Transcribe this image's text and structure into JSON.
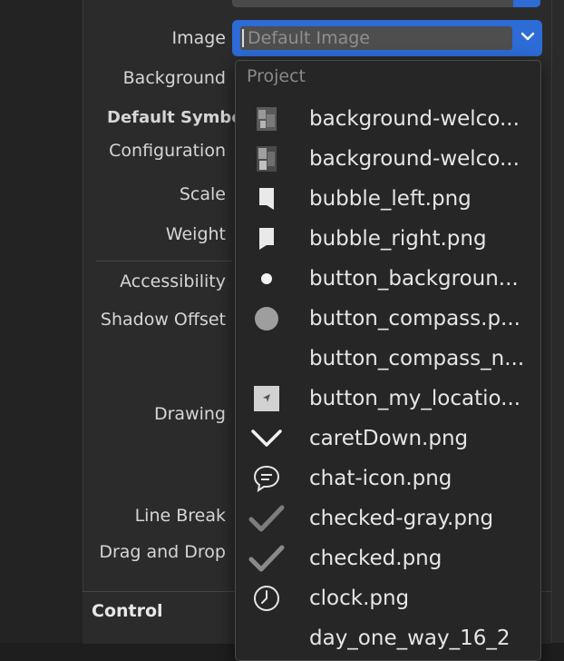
{
  "inspector": {
    "labels": {
      "image": "Image",
      "background": "Background",
      "default_symbol": "Default Symbo",
      "configuration": "Configuration",
      "scale": "Scale",
      "weight": "Weight",
      "accessibility": "Accessibility",
      "shadow_offset": "Shadow Offset",
      "drawing": "Drawing",
      "line_break": "Line Break",
      "drag_and_drop": "Drag and Drop"
    },
    "section_control": "Control"
  },
  "image_combo": {
    "value": "Default Image",
    "arrow_icon": "chevron-down-icon",
    "accent_color": "#2d6bd6"
  },
  "dropdown": {
    "header": "Project",
    "items": [
      {
        "label": "background-welco...",
        "icon": "photo-thumbnail-icon"
      },
      {
        "label": "background-welco...",
        "icon": "photo-thumbnail-icon"
      },
      {
        "label": "bubble_left.png",
        "icon": "bubble-left-icon"
      },
      {
        "label": "bubble_right.png",
        "icon": "bubble-right-icon"
      },
      {
        "label": "button_backgroun...",
        "icon": "dot-icon"
      },
      {
        "label": "button_compass.p...",
        "icon": "gray-circle-icon"
      },
      {
        "label": "button_compass_n...",
        "icon": "blank-icon"
      },
      {
        "label": "button_my_locatio...",
        "icon": "location-arrow-icon"
      },
      {
        "label": "caretDown.png",
        "icon": "caret-down-icon"
      },
      {
        "label": "chat-icon.png",
        "icon": "chat-bubble-icon"
      },
      {
        "label": "checked-gray.png",
        "icon": "checkmark-gray-icon"
      },
      {
        "label": "checked.png",
        "icon": "checkmark-icon"
      },
      {
        "label": "clock.png",
        "icon": "clock-icon"
      },
      {
        "label": "day_one_way_16_2",
        "icon": "blank-icon"
      }
    ]
  }
}
